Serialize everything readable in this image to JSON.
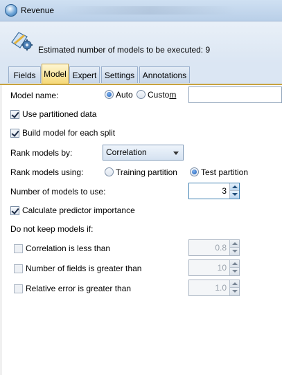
{
  "window": {
    "title": "Revenue"
  },
  "header": {
    "message": "Estimated number of models to be executed: 9"
  },
  "tabs": [
    {
      "label": "Fields",
      "active": false
    },
    {
      "label": "Model",
      "active": true
    },
    {
      "label": "Expert",
      "active": false
    },
    {
      "label": "Settings",
      "active": false
    },
    {
      "label": "Annotations",
      "active": false
    }
  ],
  "form": {
    "model_name": {
      "label": "Model name:",
      "option_auto": "Auto",
      "option_custom_prefix": "Custo",
      "option_custom_ul": "m",
      "selected": "Auto",
      "custom_value": ""
    },
    "use_partitioned": {
      "label": "Use partitioned data",
      "checked": true
    },
    "build_each_split": {
      "label": "Build model for each split",
      "checked": true
    },
    "rank_by": {
      "label": "Rank models by:",
      "value": "Correlation"
    },
    "rank_using": {
      "label": "Rank models using:",
      "option_training": "Training partition",
      "option_test": "Test partition",
      "selected": "Test partition"
    },
    "num_models": {
      "label": "Number of models to use:",
      "value": "3"
    },
    "predictor_importance": {
      "label": "Calculate predictor importance",
      "checked": true
    },
    "discard_heading": "Do not keep models if:",
    "discard_rules": [
      {
        "label": "Correlation is less than",
        "checked": false,
        "value": "0.8"
      },
      {
        "label": "Number of fields is greater than",
        "checked": false,
        "value": "10"
      },
      {
        "label": "Relative error is greater than",
        "checked": false,
        "value": "1.0"
      }
    ]
  },
  "colors": {
    "active_tab": "#f5d877",
    "accent_border": "#3c7fb1",
    "header_bg": "#dbe6f3"
  }
}
